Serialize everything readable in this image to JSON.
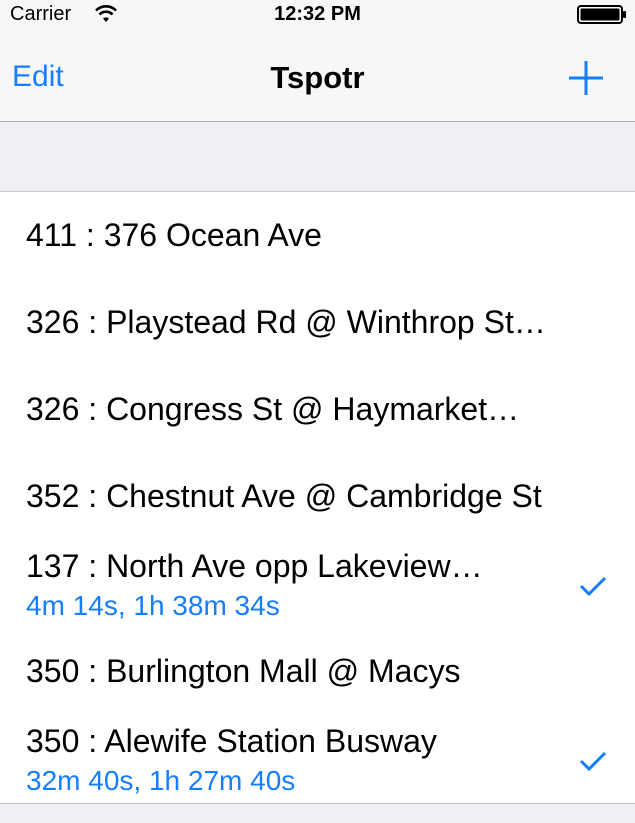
{
  "status": {
    "carrier": "Carrier",
    "time": "12:32 PM"
  },
  "nav": {
    "edit_label": "Edit",
    "title": "Tspotr",
    "add_icon": "plus-icon"
  },
  "colors": {
    "accent": "#157efb",
    "background": "#efeff4",
    "separator": "#c8c7cc"
  },
  "rows": [
    {
      "title": "411 : 376 Ocean Ave",
      "subtitle": "",
      "checked": false
    },
    {
      "title": "326 : Playstead Rd @ Winthrop St…",
      "subtitle": "",
      "checked": false
    },
    {
      "title": "326 : Congress St @ Haymarket…",
      "subtitle": "",
      "checked": false
    },
    {
      "title": "352 : Chestnut Ave @ Cambridge St",
      "subtitle": "",
      "checked": false
    },
    {
      "title": "137 : North Ave opp Lakeview…",
      "subtitle": "4m 14s, 1h 38m 34s",
      "checked": true
    },
    {
      "title": "350 : Burlington Mall @ Macys",
      "subtitle": "",
      "checked": false
    },
    {
      "title": "350 : Alewife Station Busway",
      "subtitle": "32m 40s, 1h 27m 40s",
      "checked": true
    }
  ]
}
